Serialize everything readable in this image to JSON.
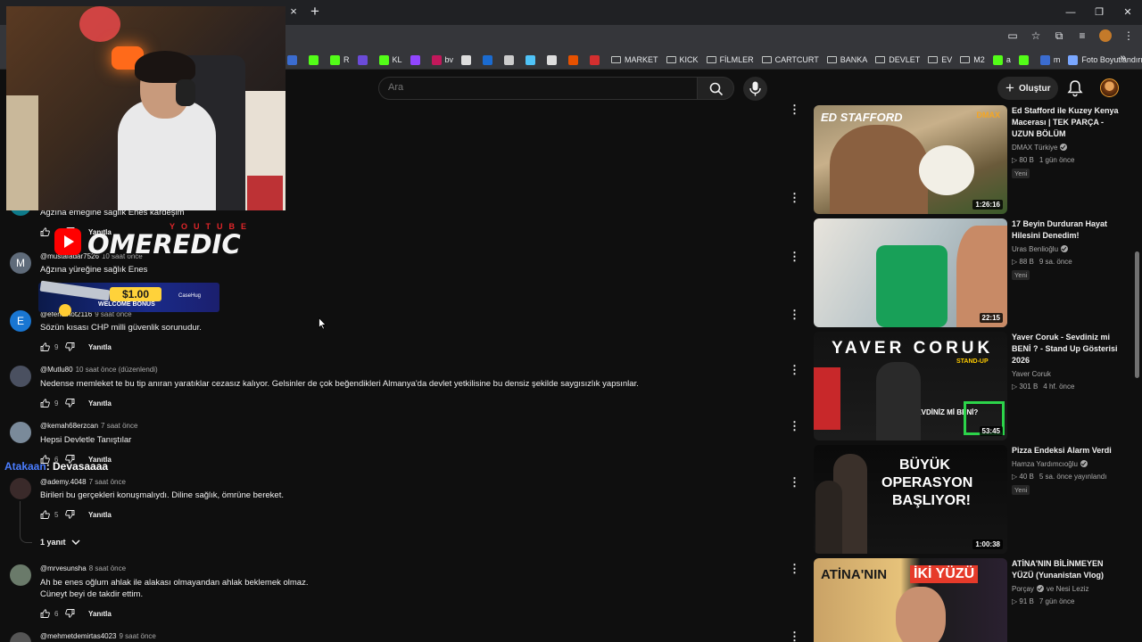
{
  "browser": {
    "tab_close": "×",
    "tab_new": "+",
    "window_controls": [
      "—",
      "❐",
      "✕"
    ],
    "bookmarks": [
      {
        "label": "",
        "color": "#3b6ccf",
        "icon": "m-icon"
      },
      {
        "label": "",
        "color": "#53fc18",
        "icon": "kick-icon"
      },
      {
        "label": "R",
        "color": "#53fc18",
        "icon": "kick-icon"
      },
      {
        "label": "",
        "color": "#6b4bd8",
        "icon": "app-icon"
      },
      {
        "label": "KL",
        "color": "#53fc18",
        "icon": "kick-icon"
      },
      {
        "label": "",
        "color": "#9146ff",
        "icon": "twitch-icon"
      },
      {
        "label": "bv",
        "color": "#c2185b",
        "icon": "app-icon"
      },
      {
        "label": "",
        "color": "#dddddd",
        "icon": "globe-icon"
      },
      {
        "label": "",
        "color": "#1b6bd0",
        "icon": "steam-icon"
      },
      {
        "label": "",
        "color": "#cccccc",
        "icon": "app-icon"
      },
      {
        "label": "",
        "color": "#4fc3f7",
        "icon": "app-icon"
      },
      {
        "label": "",
        "color": "#dddddd",
        "icon": "openai-icon"
      },
      {
        "label": "",
        "color": "#e65100",
        "icon": "app-icon"
      },
      {
        "label": "",
        "color": "#d32f2f",
        "icon": "app-icon"
      }
    ],
    "bookmark_folders": [
      "MARKET",
      "KICK",
      "FİLMLER",
      "CARTCURT",
      "BANKA",
      "DEVLET",
      "EV",
      "M2"
    ],
    "bookmark_tail": [
      {
        "label": "a",
        "color": "#53fc18",
        "icon": "app-icon"
      },
      {
        "label": "",
        "color": "#53fc18",
        "icon": "kick-icon"
      },
      {
        "label": "m",
        "color": "#3b6ccf",
        "icon": "m-icon"
      },
      {
        "label": "Foto Boyutlandırıcı",
        "color": "#7aa7ff",
        "icon": "heart-icon"
      }
    ],
    "bookmarks_more": "»"
  },
  "youtube": {
    "search_placeholder": "Ara",
    "create_plus": "+",
    "create_label": "Oluştur"
  },
  "overlay": {
    "yt_sub": "YOUTUBE",
    "brand": "OMEREDIC",
    "promo_amount": "$1.00",
    "promo_text": "WELCOME BONUS",
    "promo_brand": "CaseHug",
    "chat_nick": "Atakaan",
    "chat_text": ": Devasaaaa"
  },
  "comments": [
    {
      "author": "",
      "time": "",
      "text": "Ağzına emeğine sağlık Enes kardeşim",
      "likes": "",
      "avatar_letter": "",
      "avatar_color": "#0d7a8a"
    },
    {
      "author": "@mustafadar7526",
      "time": "10 saat önce",
      "text": "Ağzına yüreğine sağlık Enes",
      "likes": "",
      "avatar_letter": "M",
      "avatar_color": "#5f6b7a"
    },
    {
      "author": "@efendinot2116",
      "time": "9 saat önce",
      "text": "Sözün kısası CHP milli güvenlik sorunudur.",
      "likes": "9",
      "avatar_letter": "E",
      "avatar_color": "#1976d2"
    },
    {
      "author": "@Mutlu80",
      "time": "10 saat önce (düzenlendi)",
      "text": "Nedense memleket te bu tip anıran yaratıklar cezasız kalıyor. Gelsinler de çok beğendikleri Almanya'da devlet yetkilisine bu densiz şekilde saygısızlık yapsınlar.",
      "likes": "9",
      "avatar_letter": "",
      "avatar_color": "#4a5060"
    },
    {
      "author": "@kemah68erzcan",
      "time": "7 saat önce",
      "text": "Hepsi Devletle Tanıştılar",
      "likes": "6",
      "avatar_letter": "",
      "avatar_color": "#7a8a9a"
    },
    {
      "author": "@ademy.4048",
      "time": "7 saat önce",
      "text": "Birileri bu gerçekleri konuşmalıydı. Diline sağlık, ömrüne bereket.",
      "likes": "5",
      "avatar_letter": "",
      "avatar_color": "#3a2a2a"
    },
    {
      "author": "@mrvesunsha",
      "time": "8 saat önce",
      "text": "Ah be enes oğlum ahlak ile alakası olmayandan ahlak beklemek olmaz.",
      "text2": "Cüneyt beyi de takdir ettim.",
      "likes": "6",
      "avatar_letter": "",
      "avatar_color": "#6a7a6a"
    },
    {
      "author": "@mehmetdemirtas4023",
      "time": "9 saat önce",
      "text": "",
      "likes": "",
      "avatar_letter": "",
      "avatar_color": "#555"
    }
  ],
  "reply_label": "Yanıtla",
  "replies_toggle": "1 yanıt",
  "menu_glyph": "⋮",
  "recommendations": [
    {
      "title": "Ed Stafford ile Kuzey Kenya Macerası | TEK PARÇA - UZUN BÖLÜM",
      "channel": "DMAX Türkiye",
      "verified": true,
      "views": "▷ 80 B",
      "age": "1 gün önce",
      "badge": "Yeni",
      "duration": "1:26:16",
      "thumb_line1": "ED STAFFORD",
      "thumb_line2": "",
      "thumb_logo": "DMAX"
    },
    {
      "title": "17 Beyin Durduran Hayat Hilesini Denedim!",
      "channel": "Uras Benlioğlu",
      "verified": true,
      "views": "▷ 88 B",
      "age": "9 sa. önce",
      "badge": "Yeni",
      "duration": "22:15",
      "thumb_line1": "",
      "thumb_line2": "",
      "thumb_logo": ""
    },
    {
      "title": "Yaver Coruk - Sevdiniz mi BENİ ? - Stand Up Gösterisi 2026",
      "channel": "Yaver Coruk",
      "verified": false,
      "views": "▷ 301 B",
      "age": "4 hf. önce",
      "badge": "",
      "duration": "53:45",
      "thumb_line1": "YAVER CORUK",
      "thumb_line2": "SEVDİNİZ Mİ BENİ?",
      "thumb_logo": "STAND-UP"
    },
    {
      "title": "Pizza Endeksi Alarm Verdi",
      "channel": "Hamza Yardımcıoğlu",
      "verified": true,
      "views": "▷ 40 B",
      "age": "5 sa. önce yayınlandı",
      "badge": "Yeni",
      "duration": "1:00:38",
      "thumb_line1": "BÜYÜK",
      "thumb_line2": "OPERASYON",
      "thumb_line3": "BAŞLIYOR!",
      "thumb_logo": ""
    },
    {
      "title": "ATİNA'NIN BİLİNMEYEN YÜZÜ (Yunanistan Vlog)",
      "channel": "Porçay",
      "channel2": "ve Nesi Leziz",
      "verified": true,
      "views": "▷ 91 B",
      "age": "7 gün önce",
      "badge": "",
      "duration": "",
      "thumb_line1": "ATİNA'NIN",
      "thumb_line2": "İKİ YÜZÜ",
      "thumb_logo": ""
    }
  ]
}
